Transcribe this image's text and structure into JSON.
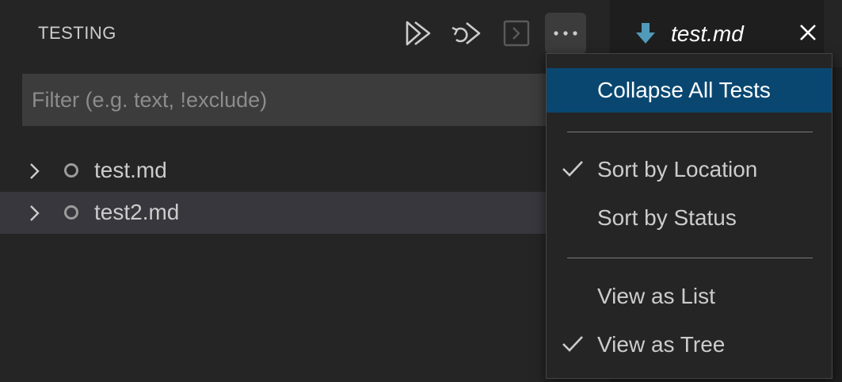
{
  "panel": {
    "title": "TESTING",
    "toolbar": [
      {
        "icon": "run-all-icon"
      },
      {
        "icon": "debug-all-icon"
      },
      {
        "icon": "show-output-icon"
      },
      {
        "icon": "more-actions-icon"
      }
    ]
  },
  "filter": {
    "placeholder": "Filter (e.g. text, !exclude)",
    "value": ""
  },
  "tree": {
    "items": [
      {
        "label": "test.md",
        "status_icon": "circle-outline-icon"
      },
      {
        "label": "test2.md",
        "status_icon": "circle-outline-icon"
      }
    ]
  },
  "editor_tab": {
    "label": "test.md",
    "icon": "markdown-down-arrow-icon",
    "close_icon": "close-icon"
  },
  "menu": {
    "items": [
      {
        "label": "Collapse All Tests",
        "checked": false,
        "selected": true
      },
      {
        "label": "Sort by Location",
        "checked": true,
        "selected": false
      },
      {
        "label": "Sort by Status",
        "checked": false,
        "selected": false
      },
      {
        "label": "View as List",
        "checked": false,
        "selected": false
      },
      {
        "label": "View as Tree",
        "checked": true,
        "selected": false
      }
    ]
  },
  "colors": {
    "menu_selected": "#094771",
    "panel_bg": "#252526",
    "editor_bg": "#1e1e1e",
    "markdown_icon": "#519aba"
  }
}
